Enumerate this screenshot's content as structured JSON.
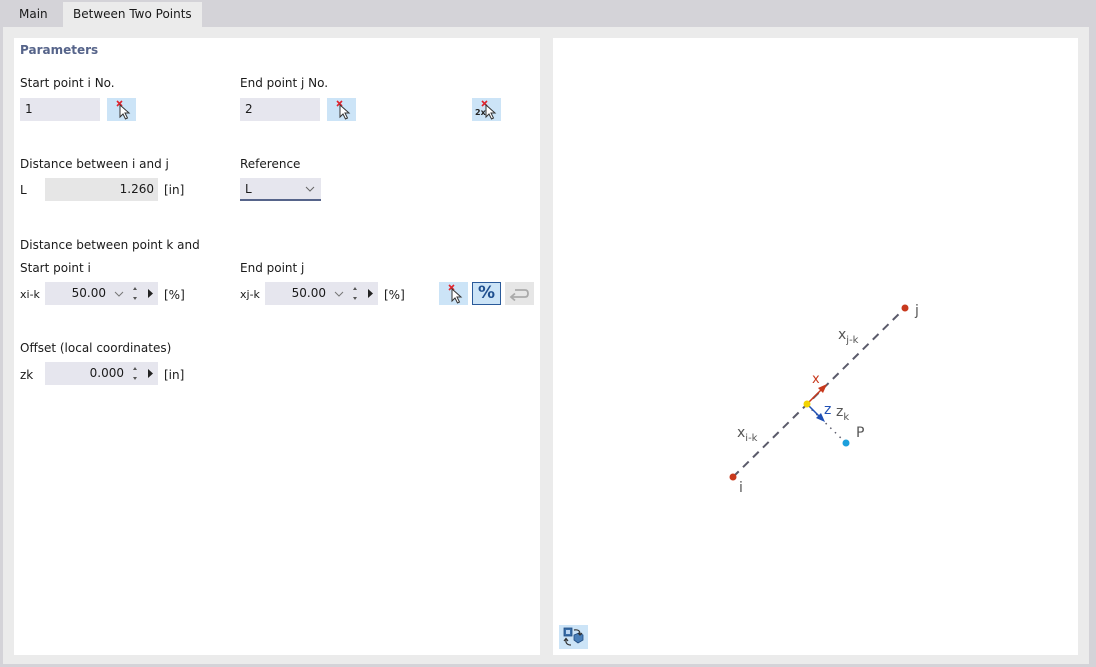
{
  "tabs": [
    {
      "label": "Main",
      "active": false
    },
    {
      "label": "Between Two Points",
      "active": true
    }
  ],
  "parameters": {
    "title": "Parameters",
    "start_point": {
      "label": "Start point i No.",
      "value": "1"
    },
    "end_point": {
      "label": "End point j No.",
      "value": "2"
    },
    "pick_two_label": "2x",
    "distance": {
      "label": "Distance between i and j",
      "symbol": "L",
      "value": "1.260",
      "unit": "[in]"
    },
    "reference": {
      "label": "Reference",
      "value": "L"
    },
    "distance_k": {
      "label": "Distance between point k and",
      "start": {
        "label": "Start point i",
        "symbol": "xi-k",
        "value": "50.00",
        "unit": "[%]"
      },
      "end": {
        "label": "End point j",
        "symbol": "xj-k",
        "value": "50.00",
        "unit": "[%]"
      }
    },
    "percent_label": "%",
    "offset": {
      "label": "Offset (local coordinates)",
      "symbol": "zk",
      "value": "0.000",
      "unit": "[in]"
    }
  },
  "diagram": {
    "point_i": "i",
    "point_j": "j",
    "point_p": "P",
    "label_xjk": "x",
    "label_xjk_sub": "j-k",
    "label_xik": "x",
    "label_xik_sub": "i-k",
    "axis_x": "x",
    "axis_z": "z",
    "label_zk": "z",
    "label_zk_sub": "k",
    "colors": {
      "endpoint": "#c8391d",
      "k_point": "#f2d300",
      "p_point": "#1c9fdc",
      "x_axis": "#c8391d",
      "z_axis": "#1f4fb4",
      "line": "#5a5a6a"
    }
  }
}
